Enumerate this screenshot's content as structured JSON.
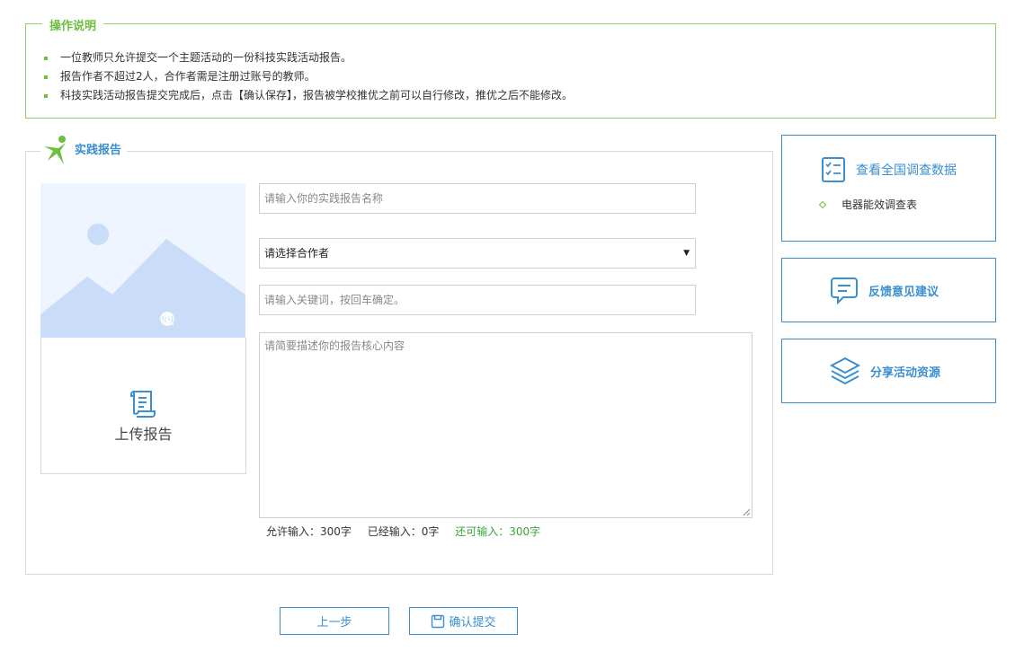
{
  "instructions": {
    "title": "操作说明",
    "items": [
      "一位教师只允许提交一个主题活动的一份科技实践活动报告。",
      "报告作者不超过2人，合作者需是注册过账号的教师。",
      "科技实践活动报告提交完成后，点击【确认保存】，报告被学校推优之前可以自行修改，推优之后不能修改。"
    ]
  },
  "report": {
    "title": "实践报告",
    "upload_label": "上传报告",
    "name_placeholder": "请输入你的实践报告名称",
    "coauthor_select": "请选择合作者",
    "keywords_placeholder": "请输入关键词，按回车确定。",
    "desc_placeholder": "请简要描述你的报告核心内容",
    "counts": {
      "allowed": "允许输入：300字",
      "entered": "已经输入：0字",
      "remaining": "还可输入：300字"
    }
  },
  "side": {
    "survey_title": "查看全国调查数据",
    "survey_item": "电器能效调查表",
    "feedback": "反馈意见建议",
    "share": "分享活动资源"
  },
  "buttons": {
    "prev": "上一步",
    "submit": "确认提交"
  },
  "colors": {
    "accent_blue": "#3a8fd0",
    "accent_green": "#6cbf3f"
  }
}
